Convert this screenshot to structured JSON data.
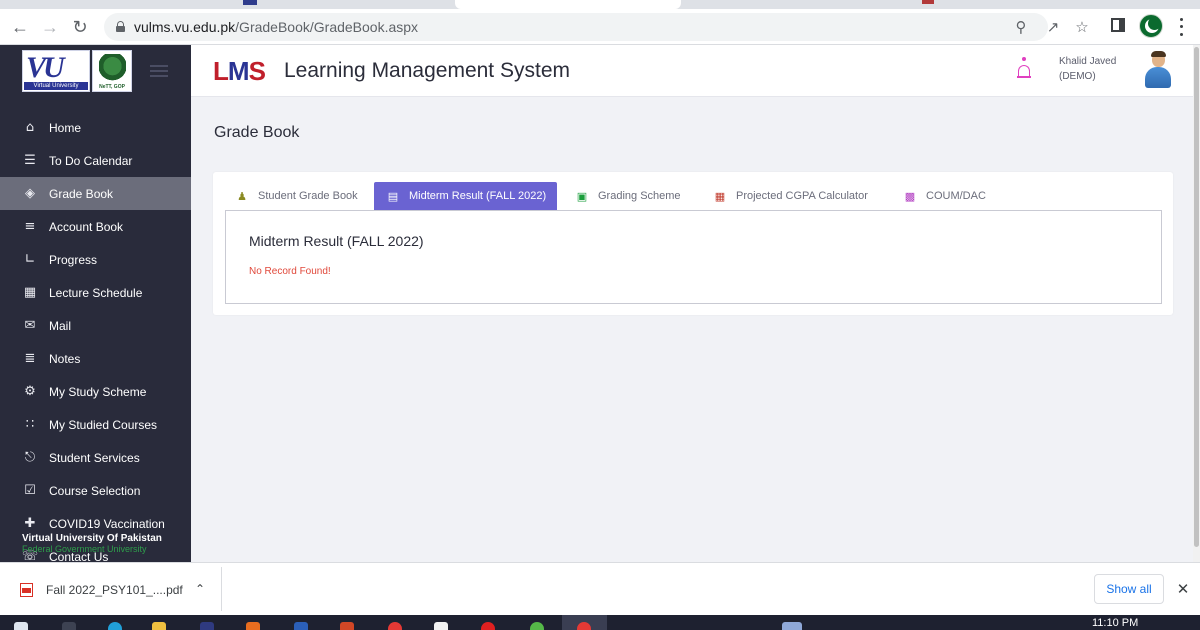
{
  "browser": {
    "url_host": "vulms.vu.edu.pk",
    "url_path": "/GradeBook/GradeBook.aspx"
  },
  "sidebar": {
    "logo_text": "VU",
    "logo_sub": "Virtual University",
    "gov_logo_sub": "NeTT, GOP",
    "items": [
      {
        "label": "Home",
        "icon": "home-icon"
      },
      {
        "label": "To Do Calendar",
        "icon": "list-icon"
      },
      {
        "label": "Grade Book",
        "icon": "layers-icon",
        "active": true
      },
      {
        "label": "Account Book",
        "icon": "sliders-icon"
      },
      {
        "label": "Progress",
        "icon": "chart-icon"
      },
      {
        "label": "Lecture Schedule",
        "icon": "calendar-icon"
      },
      {
        "label": "Mail",
        "icon": "mail-icon"
      },
      {
        "label": "Notes",
        "icon": "checklist-icon"
      },
      {
        "label": "My Study Scheme",
        "icon": "gear-icon"
      },
      {
        "label": "My Studied Courses",
        "icon": "grid-icon"
      },
      {
        "label": "Student Services",
        "icon": "bag-icon"
      },
      {
        "label": "Course Selection",
        "icon": "calendar-check-icon"
      },
      {
        "label": "COVID19 Vaccination",
        "icon": "medical-kit-icon"
      },
      {
        "label": "Contact Us",
        "icon": "phone-icon"
      }
    ],
    "footer_title": "Virtual University Of Pakistan",
    "footer_subtitle": "Federal Government University"
  },
  "header": {
    "logo_text": "LMS",
    "title": "Learning Management System",
    "user_name": "Khalid Javed",
    "user_role": "(DEMO)"
  },
  "page": {
    "title": "Grade Book",
    "tabs": [
      {
        "label": "Student Grade Book",
        "icon": "student-icon"
      },
      {
        "label": "Midterm Result (FALL 2022)",
        "icon": "clipboard-icon",
        "active": true
      },
      {
        "label": "Grading Scheme",
        "icon": "grading-icon"
      },
      {
        "label": "Projected CGPA Calculator",
        "icon": "calculator-icon"
      },
      {
        "label": "COUM/DAC",
        "icon": "id-card-icon"
      }
    ],
    "panel_title": "Midterm Result (FALL 2022)",
    "empty_message": "No Record Found!"
  },
  "downloads": {
    "file_name": "Fall 2022_PSY101_....pdf",
    "show_all": "Show all"
  },
  "taskbar": {
    "time": "11:10 PM"
  },
  "colors": {
    "sidebar_bg": "#292b3b",
    "active_tab": "#6a63d2",
    "error_text": "#e0483a",
    "brand_red": "#c01f2b",
    "brand_blue": "#2a3494"
  }
}
